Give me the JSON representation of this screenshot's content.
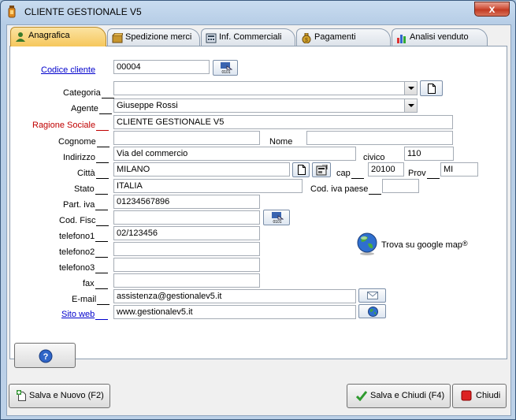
{
  "window": {
    "title": "CLIENTE GESTIONALE V5",
    "close_label": "x"
  },
  "tabs": [
    {
      "label": "Anagrafica",
      "active": true
    },
    {
      "label": "Spedizione merci"
    },
    {
      "label": "Inf. Commerciali"
    },
    {
      "label": "Pagamenti"
    },
    {
      "label": "Analisi venduto"
    }
  ],
  "form": {
    "codice_cliente": {
      "label": "Codice cliente",
      "value": "00004"
    },
    "categoria": {
      "label": "Categoria",
      "value": ""
    },
    "agente": {
      "label": "Agente",
      "value": "Giuseppe Rossi"
    },
    "ragione_sociale": {
      "label": "Ragione Sociale",
      "value": "CLIENTE GESTIONALE V5"
    },
    "cognome": {
      "label": "Cognome",
      "value": ""
    },
    "nome": {
      "label": "Nome",
      "value": ""
    },
    "indirizzo": {
      "label": "Indirizzo",
      "value": "Via del commercio"
    },
    "civico": {
      "label": "civico",
      "value": "110"
    },
    "citta": {
      "label": "Città",
      "value": "MILANO"
    },
    "cap": {
      "label": "cap",
      "value": "20100"
    },
    "prov": {
      "label": "Prov",
      "value": "MI"
    },
    "stato": {
      "label": "Stato",
      "value": "ITALIA"
    },
    "cod_iva_paese": {
      "label": "Cod. iva paese",
      "value": ""
    },
    "part_iva": {
      "label": "Part. iva",
      "value": "01234567896"
    },
    "cod_fisc": {
      "label": "Cod. Fisc",
      "value": ""
    },
    "telefono1": {
      "label": "telefono1",
      "value": "02/123456"
    },
    "telefono2": {
      "label": "telefono2",
      "value": ""
    },
    "telefono3": {
      "label": "telefono3",
      "value": ""
    },
    "fax": {
      "label": "fax",
      "value": ""
    },
    "email": {
      "label": "E-mail",
      "value": "assistenza@gestionalev5.it"
    },
    "sito_web": {
      "label": "Sito web",
      "value": "www.gestionalev5.it"
    }
  },
  "google_map": {
    "label": "Trova su google map"
  },
  "buttons": {
    "help": "?",
    "salva_nuovo": "Salva e Nuovo (F2)",
    "salva_chiudi": "Salva e Chiudi (F4)",
    "chiudi": "Chiudi"
  },
  "colors": {
    "required_label": "#c00000",
    "link": "#0000cc",
    "active_tab": "#f6c75c"
  }
}
